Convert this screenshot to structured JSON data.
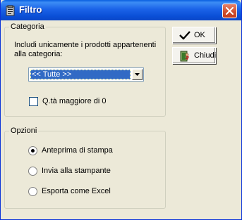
{
  "window": {
    "title": "Filtro",
    "icon": "clipboard-icon",
    "close_icon": "close-x-icon"
  },
  "categoria": {
    "legend": "Categoria",
    "description_line1": "Includi unicamente i prodotti appartenenti",
    "description_line2": "alla categoria:",
    "combo_value": "<< Tutte >>",
    "checkbox_label": "Q.tà maggiore di 0",
    "checkbox_checked": false
  },
  "opzioni": {
    "legend": "Opzioni",
    "options": [
      {
        "label": "Anteprima di stampa",
        "checked": true
      },
      {
        "label": "Invia alla stampante",
        "checked": false
      },
      {
        "label": "Esporta come Excel",
        "checked": false
      }
    ]
  },
  "buttons": {
    "ok_label": "OK",
    "ok_icon": "checkmark-icon",
    "close_label": "Chiudi",
    "close_icon": "door-exit-icon"
  },
  "colors": {
    "titlebar": "#0A4ED6",
    "window_bg": "#ECE9D8",
    "selection": "#316AC5"
  }
}
